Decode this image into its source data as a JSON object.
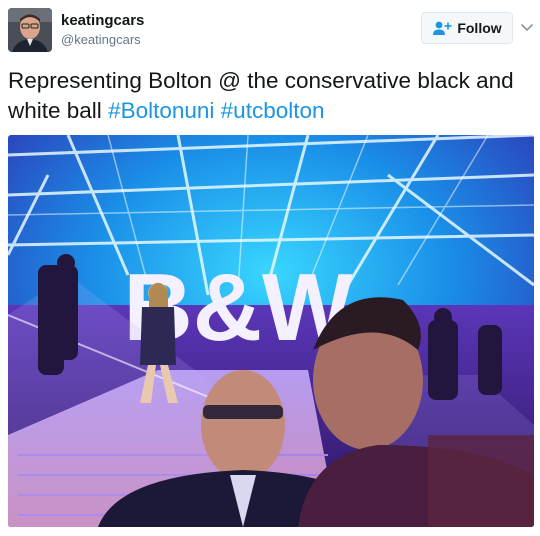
{
  "user": {
    "name": "keatingcars",
    "handle": "@keatingcars"
  },
  "follow_button": {
    "label": "Follow"
  },
  "tweet": {
    "text_start": "Representing Bolton @ the conservative black and white ball ",
    "hashtag_1": "#Boltonuni",
    "space": " ",
    "hashtag_2": "#utcbolton"
  },
  "photo": {
    "sign_text": "B&W"
  },
  "colors": {
    "link": "#1b95e0",
    "text": "#14171a",
    "muted": "#657786"
  },
  "icons": [
    "avatar",
    "follow-icon",
    "chevron-down-icon"
  ]
}
